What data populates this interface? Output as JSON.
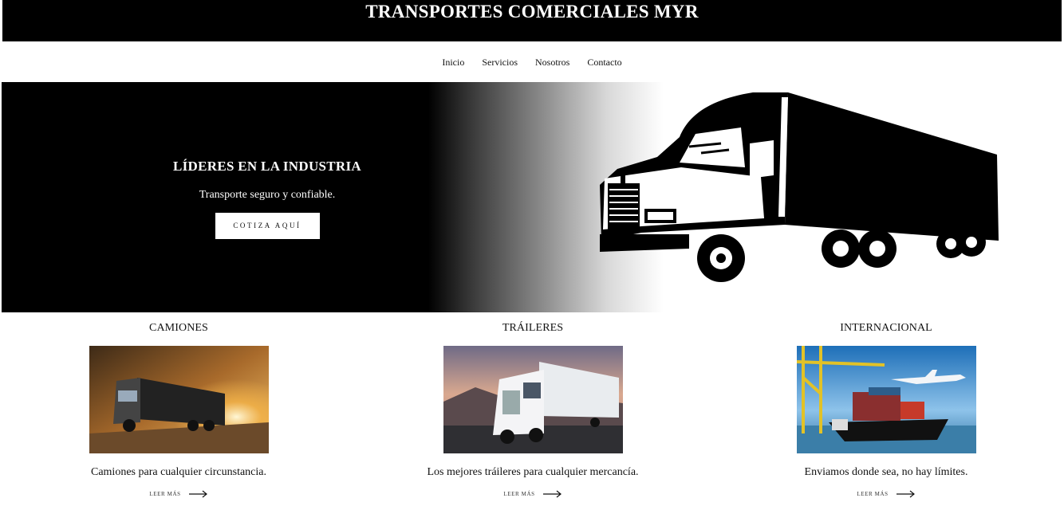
{
  "site": {
    "title": "TRANSPORTES COMERCIALES MYR"
  },
  "nav": {
    "items": [
      "Inicio",
      "Servicios",
      "Nosotros",
      "Contacto"
    ]
  },
  "hero": {
    "heading": "LÍDERES EN LA INDUSTRIA",
    "subheading": "Transporte seguro y confiable.",
    "cta_label": "COTIZA AQUÍ"
  },
  "services": [
    {
      "title": "CAMIONES",
      "description": "Camiones para cualquier circunstancia.",
      "link_label": "LEER MÁS",
      "image_icon": "truck-photo"
    },
    {
      "title": "TRÁILERES",
      "description": "Los mejores tráileres para cualquier mercancía.",
      "link_label": "LEER MÁS",
      "image_icon": "trailer-photo"
    },
    {
      "title": "INTERNACIONAL",
      "description": "Enviamos donde sea, no hay límites.",
      "link_label": "LEER MÁS",
      "image_icon": "ship-plane-photo"
    }
  ],
  "colors": {
    "banner_bg": "#000000",
    "hero_text": "#ffffff",
    "accent": "#000000"
  }
}
